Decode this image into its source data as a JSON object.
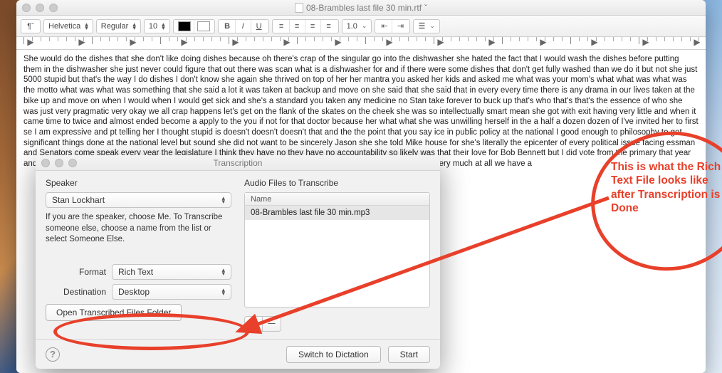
{
  "textedit": {
    "title": "08-Brambles last file 30 min.rtf",
    "edited_marker": "ˇ",
    "font_family": "Helvetica",
    "font_style": "Regular",
    "font_size": "10",
    "line_spacing": "1.0",
    "body": "She would do the dishes that she don't like doing dishes because oh there's crap of the singular go into the dishwasher she hated the fact that I would wash the dishes before putting them in the dishwasher she just never could figure that out there was scan what is a dishwasher for and if there were some dishes that don't get fully washed than we do it but not she just 5000 stupid but that's the way I do dishes I don't know she again she thrived on top of her her mantra you asked her kids and asked me what was your mom's what what was what was the motto what was what was something that she said a lot it was taken at backup and move on she said that she said that in every every time there is any drama in our lives taken at the bike up and move on when I would when I would get sick and she's a standard you taken any medicine no Stan take forever to buck up that's who that's that's the essence of who she was just very pragmatic very okay we all crap happens let's get on the flank of the skates on the cheek she was so intellectually smart mean she got with exit having very little and when it came time to twice and almost ended become a apply to the you if not for that doctor because her what what she was unwilling herself in the a half a dozen dozen of I've invited her to first se I am expressive and pt telling her I thought stupid is doesn't doesn't doesn't that and the the point that you say ice in public policy at the national I good enough to philosophy to get significant things done at the national level but sound she did not want to be sincerely Jason she she told Mike house for she's literally the epicenter of every political issue facing essman and Senators come speak every year the legislature I think they have no they have no accountability so likely was that their love for Bob Bennett but I did vote from the primary that year and I you do and Mike said well we hold hearings and we and we visit with that what you actually get done oh not very much at all we have a"
  },
  "transcription": {
    "window_title": "Transcription",
    "speaker_label": "Speaker",
    "speaker_value": "Stan Lockhart",
    "help_text": "If you are the speaker, choose Me.  To Transcribe someone else, choose a name from the list or select Someone Else.",
    "format_label": "Format",
    "format_value": "Rich Text",
    "destination_label": "Destination",
    "destination_value": "Desktop",
    "open_folder_label": "Open Transcribed Files Folder",
    "audio_label": "Audio Files to Transcribe",
    "audio_header": "Name",
    "audio_file": "08-Brambles last file 30 min.mp3",
    "switch_label": "Switch to Dictation",
    "start_label": "Start"
  },
  "annotation": {
    "text": "This is what the Rich Text File looks like after Transcription is Done"
  }
}
